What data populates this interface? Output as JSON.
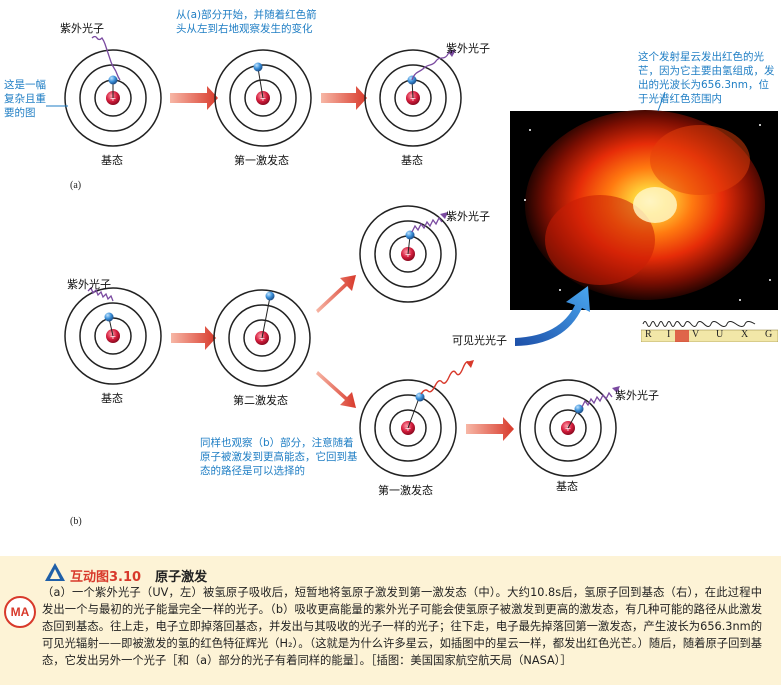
{
  "labels": {
    "uv_photon": "紫外光子",
    "visible_photon": "可见光光子",
    "ground_state": "基态",
    "first_excited": "第一激发态",
    "second_excited": "第二激发态",
    "part_a": "(a)",
    "part_b": "(b)"
  },
  "notes": {
    "left": "这是一幅复杂且重要的图",
    "top": "从(a)部分开始，并随着红色箭头从左到右地观察发生的变化",
    "nebula": "这个发射星云发出红色的光芒，因为它主要由氢组成，发出的光波长为656.3nm，位于光谱红色范围内",
    "bottom": "同样也观察（b）部分，注意随着原子被激发到更高能态，它回到基态的路径是可以选择的"
  },
  "spectrum_letters": [
    "R",
    "I",
    "V",
    "U",
    "X",
    "G"
  ],
  "caption": {
    "number": "互动图3.10",
    "title": "原子激发",
    "badge": "MA",
    "body": "（a）一个紫外光子（UV，左）被氢原子吸收后，短暂地将氢原子激发到第一激发态（中）。大约10.8s后，氢原子回到基态（右），在此过程中发出一个与最初的光子能量完全一样的光子。（b）吸收更高能量的紫外光子可能会使氢原子被激发到更高的激发态，有几种可能的路径从此激发态回到基态。往上走，电子立即掉落回基态，并发出与其吸收的光子一样的光子；往下走，电子最先掉落回第一激发态，产生波长为656.3nm的可见光辐射——即被激发的氢的红色特征辉光（H₂）。（这就是为什么许多星云，如插图中的星云一样，都发出红色光芒。）随后，随着原子回到基态，它发出另外一个光子［和（a）部分的光子有着同样的能量］。［插图：美国国家航空航天局（NASA）］"
  },
  "colors": {
    "arrow": "#d8392b",
    "note": "#1f7ec4",
    "caption_bg": "#fdf3d6",
    "uv_wave": "#7a4aa0",
    "visible_wave": "#d8392b"
  }
}
